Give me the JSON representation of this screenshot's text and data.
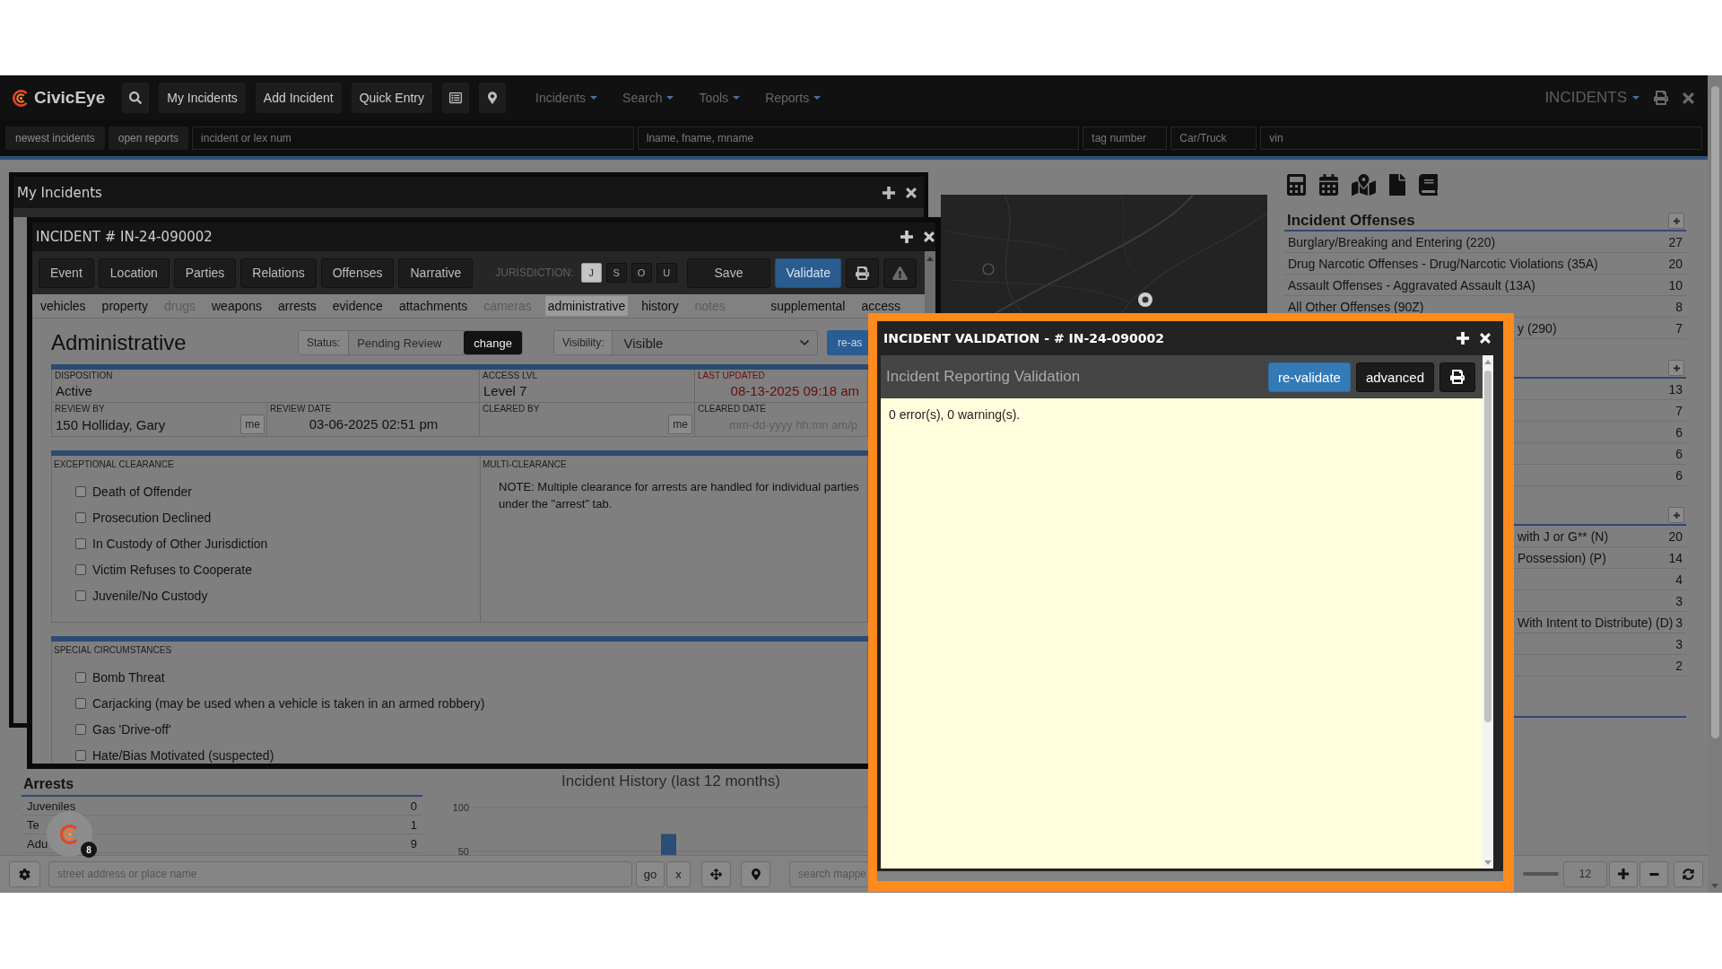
{
  "header": {
    "brand": "CivicEye",
    "buttons": [
      "My Incidents",
      "Add Incident",
      "Quick Entry"
    ],
    "menus": [
      "Incidents",
      "Search",
      "Tools",
      "Reports"
    ],
    "module": "INCIDENTS"
  },
  "quick_search": {
    "buttons": [
      "newest incidents",
      "open reports"
    ],
    "fields": [
      {
        "placeholder": "incident or lex num"
      },
      {
        "placeholder": "lname, fname, mname"
      },
      {
        "placeholder": "tag number"
      },
      {
        "placeholder": "Car/Truck"
      },
      {
        "placeholder": "vin"
      }
    ]
  },
  "my_incidents_window": {
    "title": "My Incidents"
  },
  "incident_window": {
    "title": "INCIDENT # IN-24-090002",
    "tabs": [
      "Event",
      "Location",
      "Parties",
      "Relations",
      "Offenses",
      "Narrative"
    ],
    "jurisdiction": {
      "label": "JURISDICTION:",
      "options": [
        {
          "label": "J",
          "selected": true
        },
        {
          "label": "S",
          "selected": false
        },
        {
          "label": "O",
          "selected": false
        },
        {
          "label": "U",
          "selected": false
        }
      ]
    },
    "actions": [
      {
        "label": "Save",
        "kind": "default"
      },
      {
        "label": "Validate",
        "kind": "primary"
      }
    ],
    "subtabs": {
      "left": [
        {
          "label": "vehicles",
          "selected": false,
          "disabled": false
        },
        {
          "label": "property",
          "selected": false,
          "disabled": false
        },
        {
          "label": "drugs",
          "selected": false,
          "disabled": true
        },
        {
          "label": "weapons",
          "selected": false,
          "disabled": false
        },
        {
          "label": "arrests",
          "selected": false,
          "disabled": false
        },
        {
          "label": "evidence",
          "selected": false,
          "disabled": false
        },
        {
          "label": "attachments",
          "selected": false,
          "disabled": false
        },
        {
          "label": "cameras",
          "selected": false,
          "disabled": true
        },
        {
          "label": "administrative",
          "selected": true,
          "disabled": false
        },
        {
          "label": "history",
          "selected": false,
          "disabled": false
        },
        {
          "label": "notes",
          "selected": false,
          "disabled": true
        }
      ],
      "right": [
        {
          "label": "supplemental",
          "selected": false,
          "disabled": false
        },
        {
          "label": "access",
          "selected": false,
          "disabled": false
        }
      ]
    },
    "administrative": {
      "heading": "Administrative",
      "status": {
        "label": "Status:",
        "value": "Pending Review",
        "button": "change"
      },
      "visibility": {
        "label": "Visibility:",
        "value": "Visible"
      },
      "reassign_button": "re-as",
      "field_rows": [
        [
          {
            "kind": "text",
            "label": "DISPOSITION",
            "value": "Active"
          },
          {
            "kind": "text",
            "label": "ACCESS LVL",
            "value": "Level 7"
          },
          {
            "kind": "stamp",
            "label": "LAST UPDATED",
            "value": "08-13-2025 09:18 am"
          }
        ],
        [
          {
            "kind": "person",
            "label": "REVIEW BY",
            "value": "150 Holliday, Gary",
            "button": "me"
          },
          {
            "kind": "date",
            "label": "REVIEW DATE",
            "value": "03-06-2025 02:51 pm"
          },
          {
            "kind": "person",
            "label": "CLEARED BY",
            "button": "me"
          },
          {
            "kind": "date-input",
            "label": "CLEARED DATE",
            "placeholder": "mm-dd-yyyy hh:mn am/p"
          }
        ]
      ],
      "sections": [
        {
          "label": "EXCEPTIONAL CLEARANCE",
          "options": [
            {
              "label": "Death of Offender",
              "checked": false
            },
            {
              "label": "Prosecution Declined",
              "checked": false
            },
            {
              "label": "In Custody of Other Jurisdiction",
              "checked": false
            },
            {
              "label": "Victim Refuses to Cooperate",
              "checked": false
            },
            {
              "label": "Juvenile/No Custody",
              "checked": false
            }
          ],
          "side": {
            "label": "MULTI-CLEARANCE",
            "note": "NOTE: Multiple clearance for arrests are handled for individual parties under the \"arrest\" tab."
          }
        },
        {
          "label": "SPECIAL CIRCUMSTANCES",
          "options": [
            {
              "label": "Bomb Threat",
              "checked": false
            },
            {
              "label": "Carjacking (may be used when a vehicle is taken in an armed robbery)",
              "checked": false
            },
            {
              "label": "Gas 'Drive-off'",
              "checked": false
            },
            {
              "label": "Hate/Bias Motivated (suspected)",
              "checked": false
            }
          ]
        }
      ]
    }
  },
  "offense_panel": {
    "sections": [
      {
        "title": "Incident Offenses",
        "rows": [
          {
            "kind": "full",
            "name": "Burglary/Breaking and Entering (220)",
            "count": "27"
          },
          {
            "kind": "full",
            "name": "Drug Narcotic Offenses - Drug/Narcotic Violations (35A)",
            "count": "20"
          },
          {
            "kind": "full",
            "name": "Assault Offenses - Aggravated Assault (13A)",
            "count": "10"
          },
          {
            "kind": "full",
            "name": "All Other Offenses (90Z)",
            "count": "8"
          },
          {
            "kind": "clipped",
            "name": "y (290)",
            "count": "7"
          }
        ]
      },
      {
        "rows": [
          {
            "kind": "hidden",
            "count": "13"
          },
          {
            "kind": "hidden",
            "count": "7"
          },
          {
            "kind": "hidden",
            "count": "6"
          },
          {
            "kind": "hidden",
            "count": "6"
          },
          {
            "kind": "hidden",
            "count": "6"
          }
        ]
      },
      {
        "rows": [
          {
            "kind": "clipped",
            "name": "with J or G** (N)",
            "count": "20"
          },
          {
            "kind": "clipped",
            "name": "Possession) (P)",
            "count": "14"
          },
          {
            "kind": "hidden",
            "count": "4"
          },
          {
            "kind": "hidden",
            "count": "3"
          },
          {
            "kind": "clipped",
            "name": "With Intent to Distribute) (D)",
            "count": "3"
          },
          {
            "kind": "hidden",
            "count": "3"
          },
          {
            "kind": "hidden",
            "count": "2"
          }
        ]
      }
    ]
  },
  "validation_dialog": {
    "title": "INCIDENT VALIDATION - # IN-24-090002",
    "heading": "Incident Reporting Validation",
    "buttons": [
      {
        "label": "re-validate",
        "kind": "primary"
      },
      {
        "label": "advanced",
        "kind": "dark"
      }
    ],
    "result": "0 error(s), 0 warning(s)."
  },
  "arrests": {
    "title": "Arrests",
    "rows": [
      {
        "label": "Juveniles",
        "count": "0"
      },
      {
        "label": "Te",
        "count": "1"
      },
      {
        "label": "Adu",
        "count": "9"
      }
    ]
  },
  "chat_button": {
    "badge": "8"
  },
  "incident_history": {
    "chart_data": {
      "type": "bar",
      "title": "Incident History (last 12 months)",
      "ylim": [
        46,
        100
      ],
      "yticks": [
        50,
        100
      ],
      "values": [
        70
      ]
    }
  },
  "map_bar": {
    "address": {
      "placeholder": "street address or place name"
    },
    "go_button": "go",
    "clear_button": "x",
    "search": {
      "placeholder": "search mappe"
    },
    "zoom": {
      "value": "12"
    }
  }
}
